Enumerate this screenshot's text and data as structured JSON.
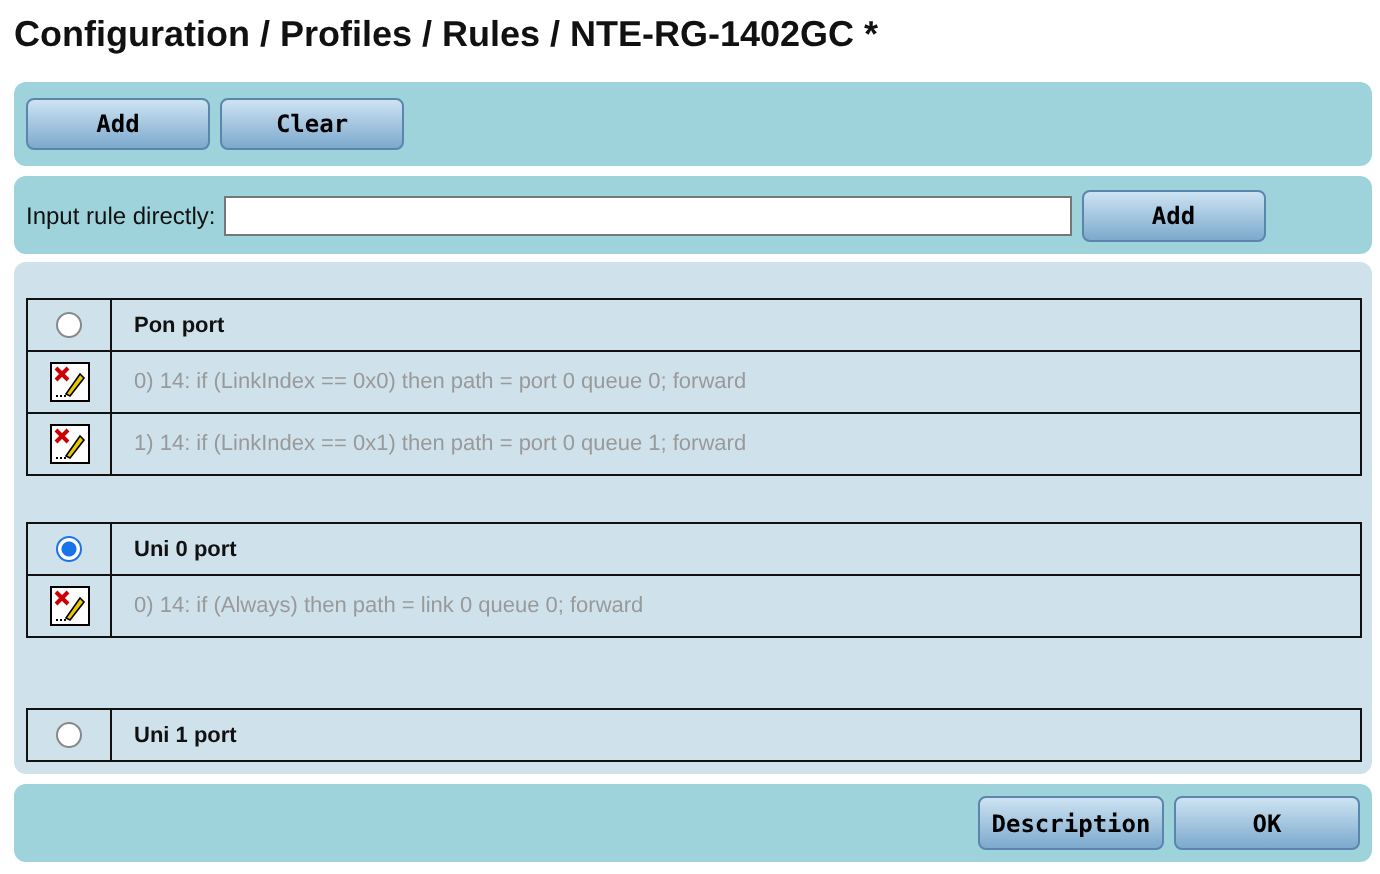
{
  "title": "Configuration / Profiles / Rules / NTE-RG-1402GC *",
  "top_buttons": [
    "Add",
    "Clear"
  ],
  "input_rule": {
    "label": "Input rule directly:",
    "button": "Add"
  },
  "ports": [
    {
      "name": "Pon port",
      "selected": false,
      "rules": [
        "0) 14: if (LinkIndex == 0x0) then path = port 0 queue 0; forward",
        "1) 14: if (LinkIndex == 0x1) then path = port 0 queue 1; forward"
      ]
    },
    {
      "name": "Uni 0 port",
      "selected": true,
      "rules": [
        "0) 14: if (Always) then path = link 0 queue 0; forward"
      ]
    },
    {
      "name": "Uni 1 port",
      "selected": false
    }
  ],
  "bottom_buttons": [
    "Description",
    "OK"
  ]
}
